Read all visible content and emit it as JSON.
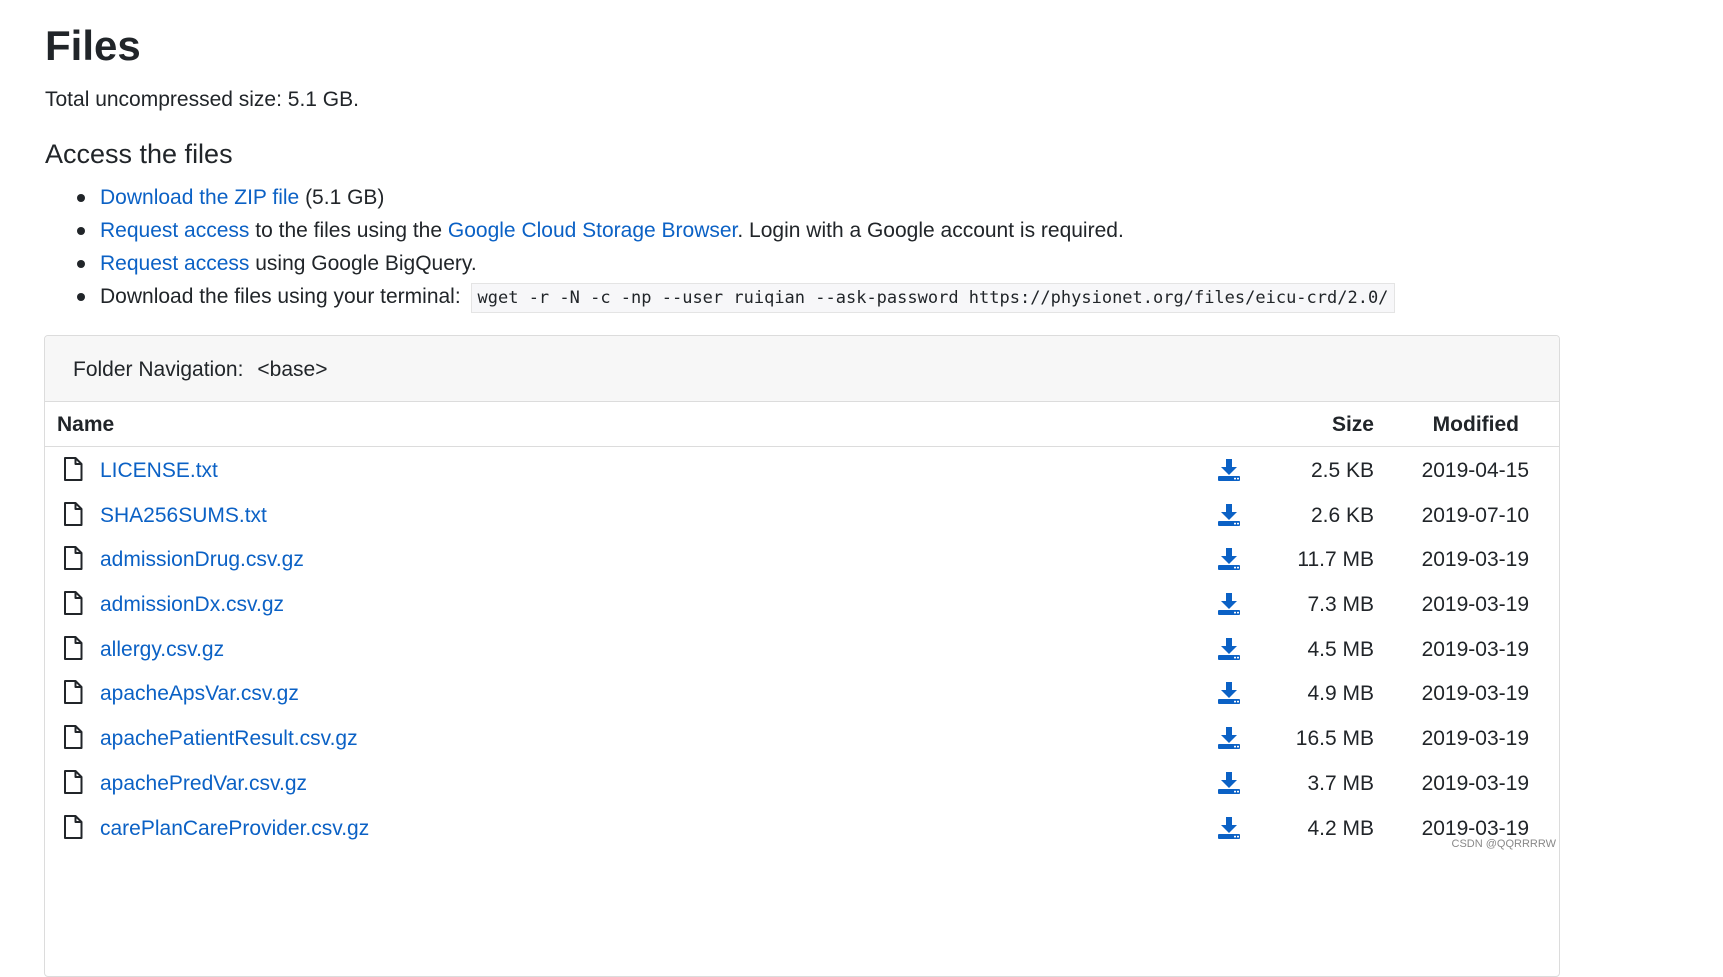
{
  "page": {
    "title": "Files",
    "total_size": "Total uncompressed size: 5.1 GB."
  },
  "access": {
    "heading": "Access the files",
    "items": [
      {
        "link": "Download the ZIP file",
        "after": " (5.1 GB)"
      },
      {
        "link": "Request access",
        "middle": " to the files using the ",
        "link2": "Google Cloud Storage Browser",
        "after": ". Login with a Google account is required."
      },
      {
        "link": "Request access",
        "after": " using Google BigQuery."
      },
      {
        "before": "Download the files using your terminal: ",
        "code": "wget -r -N -c -np --user ruiqian --ask-password https://physionet.org/files/eicu-crd/2.0/"
      }
    ]
  },
  "folder_nav": {
    "label": "Folder Navigation:",
    "current": "<base>"
  },
  "table": {
    "columns": {
      "name": "Name",
      "size": "Size",
      "modified": "Modified"
    },
    "rows": [
      {
        "name": "LICENSE.txt",
        "size": "2.5 KB",
        "modified": "2019-04-15"
      },
      {
        "name": "SHA256SUMS.txt",
        "size": "2.6 KB",
        "modified": "2019-07-10"
      },
      {
        "name": "admissionDrug.csv.gz",
        "size": "11.7 MB",
        "modified": "2019-03-19"
      },
      {
        "name": "admissionDx.csv.gz",
        "size": "7.3 MB",
        "modified": "2019-03-19"
      },
      {
        "name": "allergy.csv.gz",
        "size": "4.5 MB",
        "modified": "2019-03-19"
      },
      {
        "name": "apacheApsVar.csv.gz",
        "size": "4.9 MB",
        "modified": "2019-03-19"
      },
      {
        "name": "apachePatientResult.csv.gz",
        "size": "16.5 MB",
        "modified": "2019-03-19"
      },
      {
        "name": "apachePredVar.csv.gz",
        "size": "3.7 MB",
        "modified": "2019-03-19"
      },
      {
        "name": "carePlanCareProvider.csv.gz",
        "size": "4.2 MB",
        "modified": "2019-03-19"
      }
    ]
  },
  "watermark": "CSDN @QQRRRRW",
  "colors": {
    "link": "#0b61c5",
    "download_icon": "#0b61c5"
  },
  "icons": {
    "file": "file-icon",
    "download": "download-icon"
  }
}
